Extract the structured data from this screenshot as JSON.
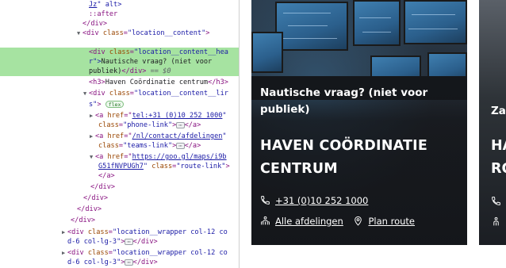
{
  "devtools": {
    "lines": {
      "l0": {
        "a": "Jz",
        "b": "\" alt>"
      },
      "l1": {
        "a": "::after"
      },
      "l2": {
        "a": "</div>"
      },
      "l3": {
        "a": "<div ",
        "an": "class",
        "av": "\"location__content\"",
        "c": ">"
      },
      "l4": {
        "a": "<div ",
        "an": "class",
        "av": "\"location__content__hea"
      },
      "l5": {
        "a": "r\">",
        "tx": "Nautische vraag? (niet voor"
      },
      "l6": {
        "tx": "publiek)",
        "a": "</div>",
        "eq": " == $0"
      },
      "l7": {
        "a": "<h3>",
        "tx": "Haven Coördinatie centrum",
        "c": "</h3>"
      },
      "l8": {
        "a": "<div ",
        "an": "class",
        "av": "\"location__content__lir"
      },
      "l9": {
        "av": "s\"",
        "c": ">",
        "pill": "flex"
      },
      "l10": {
        "a": "<a ",
        "an": "href",
        "lk": "tel:+31 (0)10 252 1000",
        "c": "\""
      },
      "l11": {
        "an": "class",
        "av": "\"phone-link\"",
        "c": ">",
        "ell": "⋯",
        "d": "</a>"
      },
      "l12": {
        "a": "<a ",
        "an": "href",
        "lk": "/nl/contact/afdelingen",
        "c": "\""
      },
      "l13": {
        "an": "class",
        "av": "\"teams-link\"",
        "c": ">",
        "ell": "⋯",
        "d": "</a>"
      },
      "l14": {
        "a": "<a ",
        "an": "href",
        "lk": "https://goo.gl/maps/i9b"
      },
      "l15": {
        "lk": "G51fNVPUGh7",
        "an": "class",
        "av": "\"route-link\"",
        "c": ">"
      },
      "l16": {
        "a": "</a>"
      },
      "l17": {
        "a": "</div>"
      },
      "l18": {
        "a": "</div>"
      },
      "l19": {
        "a": "</div>"
      },
      "l20": {
        "a": "</div>"
      },
      "l21": {
        "a": "<div ",
        "an": "class",
        "av": "\"location__wrapper col-12 co"
      },
      "l22": {
        "av": "d-6 col-lg-3\"",
        "c": ">",
        "ell": "⋯",
        "d": "</div>"
      },
      "l23": {
        "a": "<div ",
        "an": "class",
        "av": "\"location__wrapper col-12 co"
      },
      "l24": {
        "av": "d-6 col-lg-3\"",
        "c": ">",
        "ell": "⋯",
        "d": "</div>"
      }
    }
  },
  "card": {
    "subtitle": "Nautische vraag? (niet voor publiek)",
    "title": "HAVEN COÖRDINATIE CENTRUM",
    "phone": "+31 (0)10 252 1000",
    "departments": "Alle afdelingen",
    "route": "Plan route"
  },
  "card2": {
    "subtitle_partial": "Za",
    "title_partial_1": "HA",
    "title_partial_2": "RC"
  },
  "icons": {
    "phone": "phone-icon",
    "departments": "people-icon",
    "route": "location-pin-icon"
  }
}
